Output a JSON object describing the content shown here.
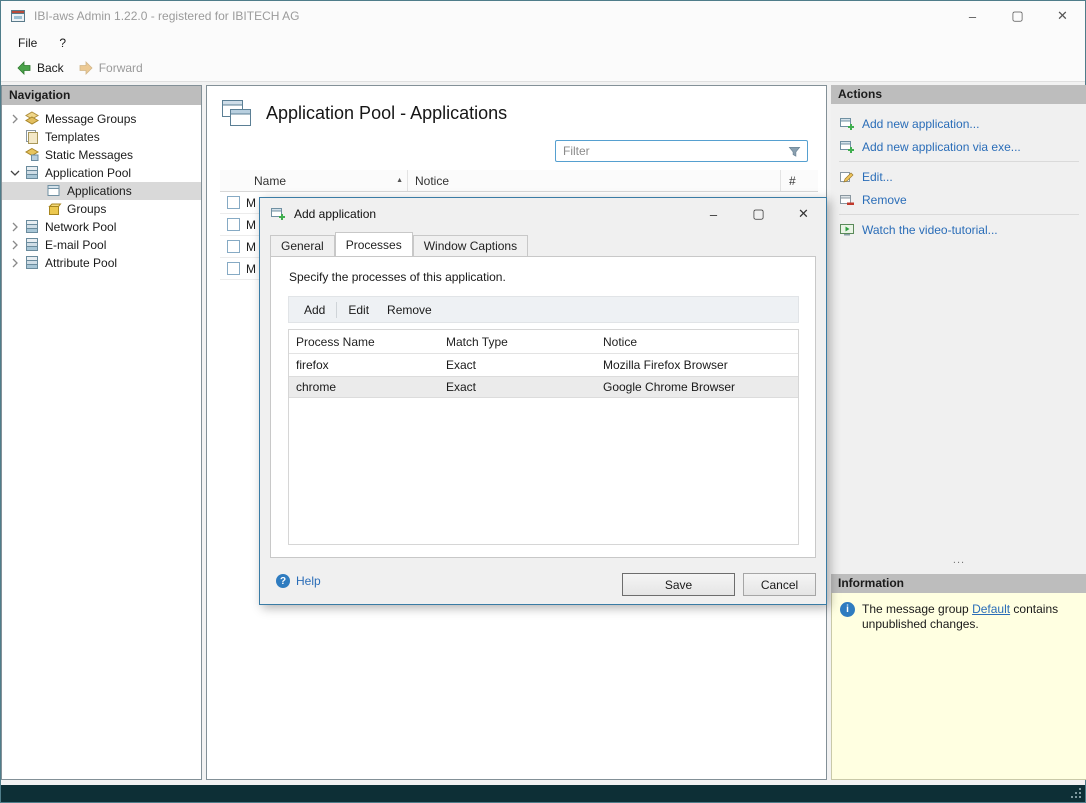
{
  "colors": {
    "link-color": "#2a6db8",
    "header-bg": "#bdbdbd",
    "info-bg": "#ffffe1",
    "statusbar-bg": "#0d2f36",
    "dialog-border": "#3a7ca5",
    "filter-border": "#56a0d0",
    "selection-bg": "#d9d9d9"
  },
  "window": {
    "title": "IBI-aws Admin 1.22.0 - registered for IBITECH AG",
    "controls": {
      "minimize": "–",
      "maximize": "▢",
      "close": "✕"
    }
  },
  "menubar": {
    "items": [
      {
        "label": "File"
      },
      {
        "label": "?"
      }
    ]
  },
  "toolbar": {
    "back_label": "Back",
    "forward_label": "Forward"
  },
  "navigation": {
    "header": "Navigation",
    "items": [
      {
        "label": "Message Groups"
      },
      {
        "label": "Templates"
      },
      {
        "label": "Static Messages"
      },
      {
        "label": "Application Pool"
      },
      {
        "label": "Applications"
      },
      {
        "label": "Groups"
      },
      {
        "label": "Network Pool"
      },
      {
        "label": "E-mail Pool"
      },
      {
        "label": "Attribute Pool"
      }
    ]
  },
  "main": {
    "title": "Application Pool - Applications",
    "filter_placeholder": "Filter",
    "sort_icon": "▲",
    "table": {
      "columns": [
        "Name",
        "Notice",
        "#"
      ],
      "rows": [
        {
          "name": "M"
        },
        {
          "name": "M"
        },
        {
          "name": "M"
        },
        {
          "name": "M"
        }
      ]
    }
  },
  "dialog": {
    "title": "Add application",
    "controls": {
      "minimize": "–",
      "maximize": "▢",
      "close": "✕"
    },
    "tabs": [
      "General",
      "Processes",
      "Window Captions"
    ],
    "description": "Specify the processes of this application.",
    "toolbar": {
      "add": "Add",
      "edit": "Edit",
      "remove": "Remove"
    },
    "table": {
      "columns": [
        "Process Name",
        "Match Type",
        "Notice"
      ],
      "rows": [
        {
          "process_name": "firefox",
          "match_type": "Exact",
          "notice": "Mozilla Firefox Browser"
        },
        {
          "process_name": "chrome",
          "match_type": "Exact",
          "notice": "Google Chrome Browser"
        }
      ]
    },
    "help_label": "Help",
    "save_label": "Save",
    "cancel_label": "Cancel"
  },
  "actions": {
    "header": "Actions",
    "items": [
      {
        "label": "Add new application..."
      },
      {
        "label": "Add new application via exe..."
      },
      {
        "label": "Edit..."
      },
      {
        "label": "Remove"
      },
      {
        "label": "Watch the video-tutorial..."
      }
    ],
    "splitter": "..."
  },
  "information": {
    "header": "Information",
    "text_before": "The message group ",
    "link": "Default",
    "text_after": " contains unpublished changes."
  }
}
